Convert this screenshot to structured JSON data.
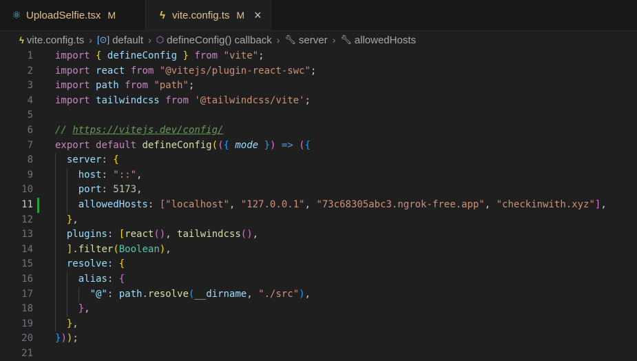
{
  "tabs": [
    {
      "label": "UploadSelfie.tsx",
      "status": "M",
      "icon": "react-icon"
    },
    {
      "label": "vite.config.ts",
      "status": "M",
      "icon": "typescript-icon"
    }
  ],
  "breadcrumb": {
    "file": "vite.config.ts",
    "items": [
      "default",
      "defineConfig() callback",
      "server",
      "allowedHosts"
    ]
  },
  "editor": {
    "current_line": 11,
    "line_numbers": [
      "1",
      "2",
      "3",
      "4",
      "5",
      "6",
      "7",
      "8",
      "9",
      "10",
      "11",
      "12",
      "13",
      "14",
      "15",
      "16",
      "17",
      "18",
      "19",
      "20",
      "21"
    ]
  },
  "code": {
    "l1": {
      "kw_import": "import",
      "open": "{",
      "name": "defineConfig",
      "close": "}",
      "kw_from": "from",
      "src": "\"vite\""
    },
    "l2": {
      "kw_import": "import",
      "name": "react",
      "kw_from": "from",
      "src": "\"@vitejs/plugin-react-swc\""
    },
    "l3": {
      "kw_import": "import",
      "name": "path",
      "kw_from": "from",
      "src": "\"path\""
    },
    "l4": {
      "kw_import": "import",
      "name": "tailwindcss",
      "kw_from": "from",
      "src": "'@tailwindcss/vite'"
    },
    "l6": {
      "comment": "// ",
      "url": "https://vitejs.dev/config/"
    },
    "l7": {
      "kw_export": "export",
      "kw_default": "default",
      "fn": "defineConfig",
      "param": "mode",
      "arrow": "=>"
    },
    "l8": {
      "key": "server"
    },
    "l9": {
      "key": "host",
      "value": "\"::\""
    },
    "l10": {
      "key": "port",
      "value": "5173"
    },
    "l11": {
      "key": "allowedHosts",
      "values": [
        "\"localhost\"",
        "\"127.0.0.1\"",
        "\"73c68305abc3.ngrok-free.app\"",
        "\"checkinwith.xyz\""
      ]
    },
    "l13": {
      "key": "plugins",
      "fn1": "react",
      "fn2": "tailwindcss"
    },
    "l14": {
      "method": "filter",
      "arg": "Boolean"
    },
    "l15": {
      "key": "resolve"
    },
    "l16": {
      "key": "alias"
    },
    "l17": {
      "key": "\"@\"",
      "obj": "path",
      "method": "resolve",
      "arg": "__dirname",
      "str": "\"./src\""
    }
  },
  "colors": {
    "background": "#1f1f1f",
    "keyword": "#c586c0",
    "string": "#ce9178",
    "function": "#dcdcaa",
    "variable": "#9cdcfe",
    "modified": "#e2c08d"
  }
}
